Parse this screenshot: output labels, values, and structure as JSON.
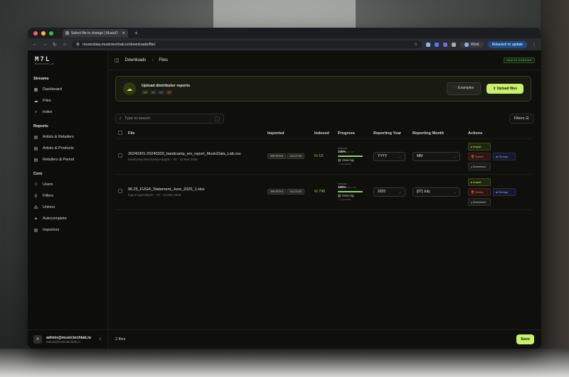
{
  "browser": {
    "tab_title": "Select file to change | MusicD",
    "url": "musicdata.musictechlab.io/downloads/file/",
    "profile": "Work",
    "relaunch": "Relaunch to update"
  },
  "sidebar": {
    "logo": "M7L",
    "logo_sub": "MUSICTECH LAB",
    "sections": [
      {
        "title": "Streams",
        "items": [
          {
            "label": "Dashboard",
            "icon": "grid-icon"
          },
          {
            "label": "Files",
            "icon": "cloud-icon"
          },
          {
            "label": "Index",
            "icon": "search-icon"
          }
        ]
      },
      {
        "title": "Reports",
        "items": [
          {
            "label": "Artists & Retailers",
            "icon": "table-icon"
          },
          {
            "label": "Artists & Products",
            "icon": "table-icon"
          },
          {
            "label": "Retailers & Period",
            "icon": "table-icon"
          }
        ]
      },
      {
        "title": "Core",
        "items": [
          {
            "label": "Users",
            "icon": "user-icon"
          },
          {
            "label": "Filters",
            "icon": "filter-icon"
          },
          {
            "label": "Unions",
            "icon": "union-icon"
          },
          {
            "label": "Autocomplete",
            "icon": "sparkle-icon"
          },
          {
            "label": "Importers",
            "icon": "table-icon"
          }
        ]
      }
    ],
    "user": {
      "avatar": "A",
      "name": "admin@musictechlab.io",
      "email": "admin@musictechlab.io"
    }
  },
  "header": {
    "crumb1": "Downloads",
    "crumb2": "Files",
    "health": "HEALTH CONSOLE"
  },
  "upload": {
    "title": "Upload distributor reports",
    "chips": [
      {
        "label": ".xlsx",
        "color": "#86d36b"
      },
      {
        "label": ".tsv",
        "color": "#86d36b"
      },
      {
        "label": ".csv",
        "color": "#8aa8f0"
      },
      {
        "label": ".zip",
        "color": "#f0a06a"
      }
    ],
    "examples": "Examples",
    "upload_btn": "Upload files"
  },
  "search": {
    "placeholder": "Type to search",
    "shortcut": "/"
  },
  "filters_label": "Filters",
  "table": {
    "headers": [
      "File",
      "Imported",
      "Indexed",
      "Progress",
      "Reporting Year",
      "Reporting Month",
      "Actions"
    ],
    "rows": [
      {
        "file": "20240301-20240329_bandcamp_rev_report_MusicData_Lab.csv",
        "sub": "bandcamp.BandcampAdapter · #3 · 13 Mar 2025",
        "imported": "IMPORTED",
        "status": "SUCCESS",
        "indexed": "10",
        "progress_label": "INDEXED",
        "progress_pct": "100%",
        "progress_count": "10 / 10",
        "progress": 1.0,
        "view_log": "View log",
        "log_detail": "Log details",
        "year": "YYYY",
        "month": "MM",
        "actions": {
          "import": "Import",
          "delete": "Delete",
          "remap": "Remap",
          "download": "Download"
        }
      },
      {
        "file": "06.25_FUGA_Statement_June_2025_1.xlsx",
        "sub": "fuga.FugaAdapter · #2 · 12 Mar 2025",
        "imported": "IMPORTED",
        "status": "SUCCESS",
        "indexed": "745",
        "progress_label": "INDEXED",
        "progress_pct": "100%",
        "progress_count": "745 / 745",
        "progress": 1.0,
        "view_log": "View log",
        "log_detail": "Log details",
        "year": "2025",
        "month": "[07] July",
        "actions": {
          "import": "Import",
          "delete": "Delete",
          "remap": "Remap",
          "download": "Download"
        }
      }
    ]
  },
  "footer": {
    "count": "2 files",
    "save": "Save"
  }
}
